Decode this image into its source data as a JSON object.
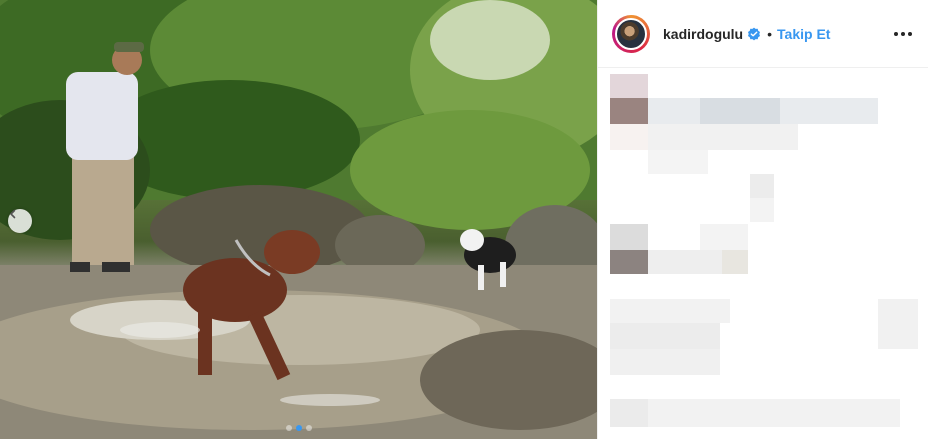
{
  "header": {
    "username": "kadirdogulu",
    "separator": "•",
    "follow_label": "Takip Et",
    "verified": true
  },
  "carousel": {
    "current_slide": 1,
    "total_slides": 3
  },
  "colors": {
    "accent": "#3897f0",
    "text": "#262626",
    "border": "#efefef"
  },
  "icons": [
    "chevron-left-icon",
    "verified-badge-icon",
    "more-options-icon"
  ]
}
